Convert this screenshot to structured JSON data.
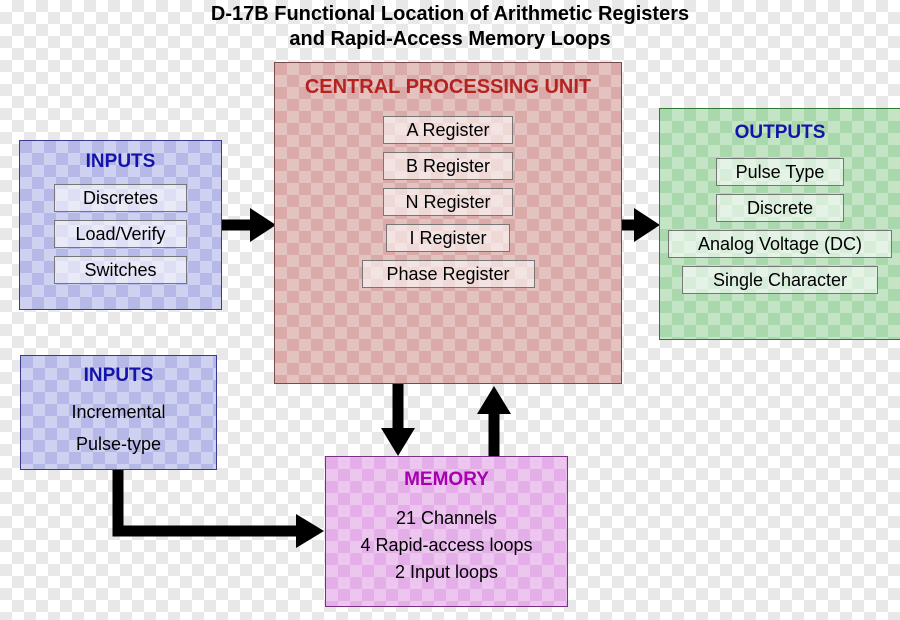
{
  "title": {
    "line1": "D-17B Functional Location of Arithmetic Registers",
    "line2": "and Rapid-Access Memory Loops"
  },
  "inputs_primary": {
    "header": "INPUTS",
    "items": [
      "Discretes",
      "Load/Verify",
      "Switches"
    ]
  },
  "inputs_secondary": {
    "header": "INPUTS",
    "items": [
      "Incremental",
      "Pulse-type"
    ]
  },
  "cpu": {
    "header": "CENTRAL PROCESSING UNIT",
    "registers": [
      "A Register",
      "B Register",
      "N Register",
      "I Register",
      "Phase Register"
    ]
  },
  "outputs": {
    "header": "OUTPUTS",
    "items": [
      "Pulse Type",
      "Discrete",
      "Analog Voltage (DC)",
      "Single Character"
    ]
  },
  "memory": {
    "header": "MEMORY",
    "lines": [
      "21 Channels",
      "4 Rapid-access loops",
      "2 Input loops"
    ]
  },
  "colors": {
    "inputs_fill": "#b6b9e8",
    "inputs_text": "#1414a8",
    "cpu_fill": "#d9aaa7",
    "cpu_text": "#b4231f",
    "outputs_fill": "#a9d8ac",
    "memory_fill": "#e4aee8",
    "memory_text": "#a600b0",
    "arrow": "#000000"
  }
}
